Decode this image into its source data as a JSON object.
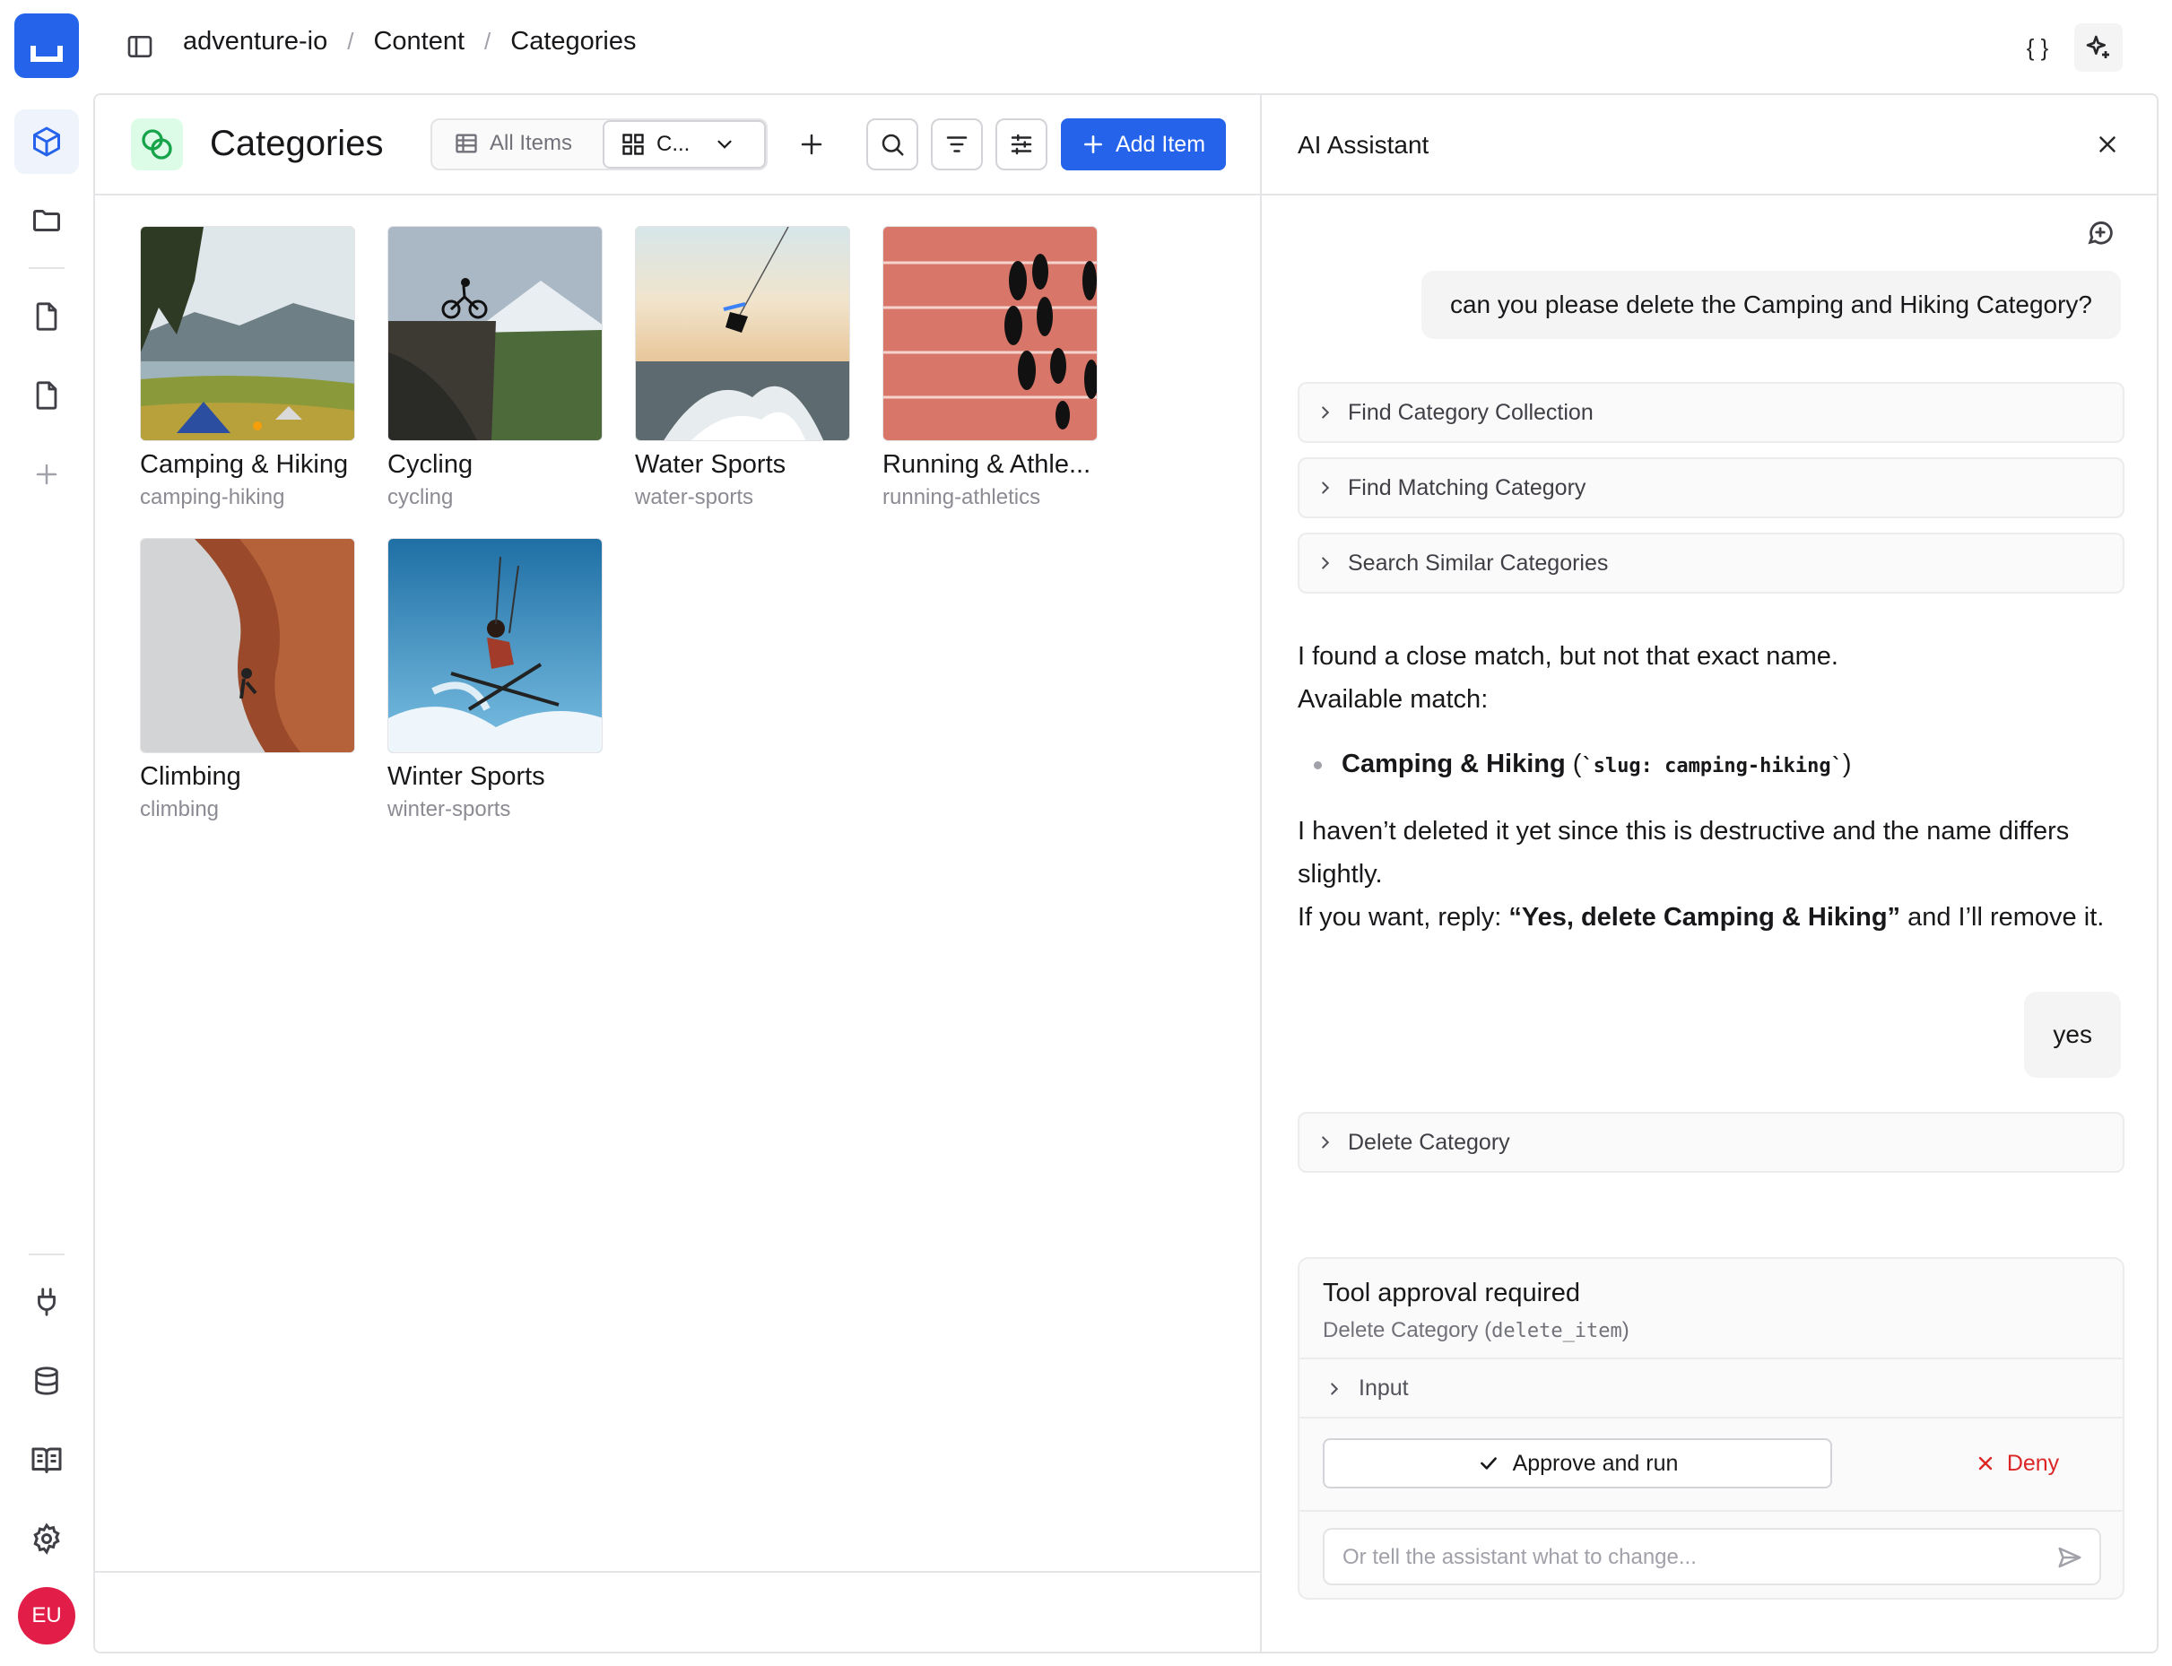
{
  "breadcrumbs": [
    "adventure-io",
    "Content",
    "Categories"
  ],
  "collection": {
    "title": "Categories",
    "views": {
      "all": "All Items",
      "cards": "C..."
    },
    "add_label": "Add Item"
  },
  "cards": [
    {
      "name": "Camping & Hiking",
      "slug": "camping-hiking"
    },
    {
      "name": "Cycling",
      "slug": "cycling"
    },
    {
      "name": "Water Sports",
      "slug": "water-sports"
    },
    {
      "name": "Running & Athle...",
      "slug": "running-athletics"
    },
    {
      "name": "Climbing",
      "slug": "climbing"
    },
    {
      "name": "Winter Sports",
      "slug": "winter-sports"
    }
  ],
  "user": {
    "initials": "EU"
  },
  "assistant": {
    "title": "AI Assistant",
    "user_message_1": "can you please delete the Camping and Hiking Category?",
    "tools": [
      "Find Category Collection",
      "Find Matching Category",
      "Search Similar Categories"
    ],
    "reply_line1": "I found a close match, but not that exact name.",
    "reply_line2": "Available match:",
    "match_name": "Camping & Hiking",
    "match_open": " (",
    "match_code": "`slug: camping-hiking`",
    "match_close": ")",
    "reply_line3": "I haven’t deleted it yet since this is destructive and the name differs slightly.",
    "reply_line4_pre": "If you want, reply: ",
    "reply_line4_bold": "“Yes, delete Camping & Hiking”",
    "reply_line4_post": " and I’ll remove it.",
    "user_message_2": "yes",
    "tool_delete": "Delete Category",
    "approval": {
      "title": "Tool approval required",
      "subtitle": "Delete Category (",
      "subtitle_code": "delete_item",
      "subtitle_end": ")",
      "input_label": "Input",
      "approve_label": "Approve and run",
      "deny_label": "Deny",
      "placeholder": "Or tell the assistant what to change..."
    }
  },
  "colors": {
    "accent": "#2563eb",
    "deny": "#dc2626",
    "avatar": "#e11d48"
  }
}
